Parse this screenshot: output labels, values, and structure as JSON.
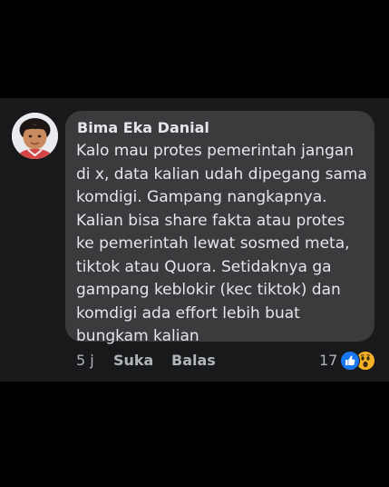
{
  "comment": {
    "author": "Bima Eka Danial",
    "lines": [
      "Kalo mau protes pemerintah jangan",
      "di x, data kalian udah dipegang sama",
      "komdigi. Gampang nangkapnya.",
      "Kalian bisa share fakta atau protes",
      "ke pemerintah lewat sosmed meta,",
      "tiktok atau Quora. Setidaknya ga",
      "gampang keblokir (kec tiktok) dan",
      "komdigi ada effort lebih buat",
      "bungkam kalian"
    ]
  },
  "actions": {
    "time": "5 j",
    "like_label": "Suka",
    "reply_label": "Balas"
  },
  "reactions": {
    "count": "17",
    "icons": [
      "like-icon",
      "wow-icon"
    ]
  },
  "colors": {
    "background": "#000000",
    "card": "#18191a",
    "bubble": "#3a3b3c",
    "text": "#e4e6eb",
    "secondary_text": "#b0b3b8",
    "like_blue": "#1877f2",
    "wow_yellow": "#f7b125"
  }
}
